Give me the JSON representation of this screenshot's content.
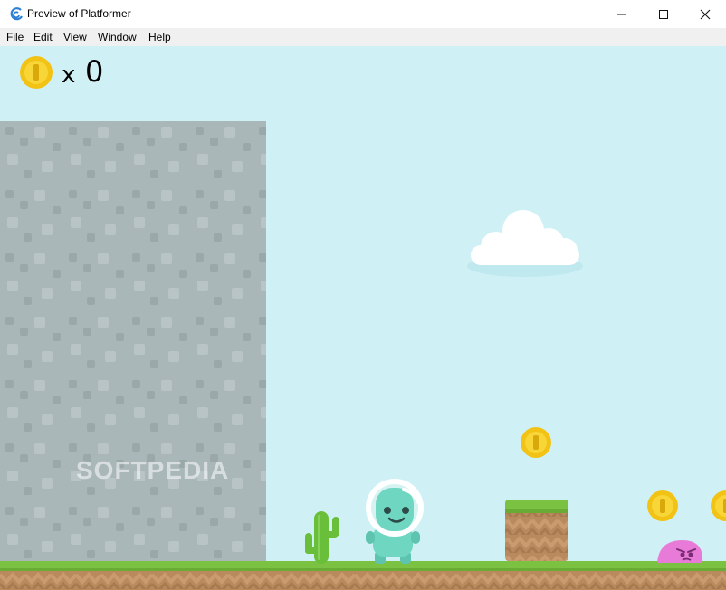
{
  "window": {
    "title": "Preview of Platformer",
    "icon": "gdevelop-logo-icon",
    "controls": [
      "minimize-icon",
      "maximize-icon",
      "close-icon"
    ]
  },
  "menu": {
    "items": [
      "File",
      "Edit",
      "View",
      "Window",
      "Help"
    ]
  },
  "hud": {
    "coin_icon": "coin-icon",
    "multiplier": "x",
    "coin_count": "0"
  },
  "watermark": "SOFTPEDIA",
  "colors": {
    "sky": "#cff1f6",
    "wall": "#a9b7b8",
    "grass": "#7cc242",
    "dirt": "#b98a5e",
    "coin": "#f2c214",
    "player": "#6fd6c2",
    "enemy": "#e87ad8",
    "cactus": "#6abf3a"
  }
}
